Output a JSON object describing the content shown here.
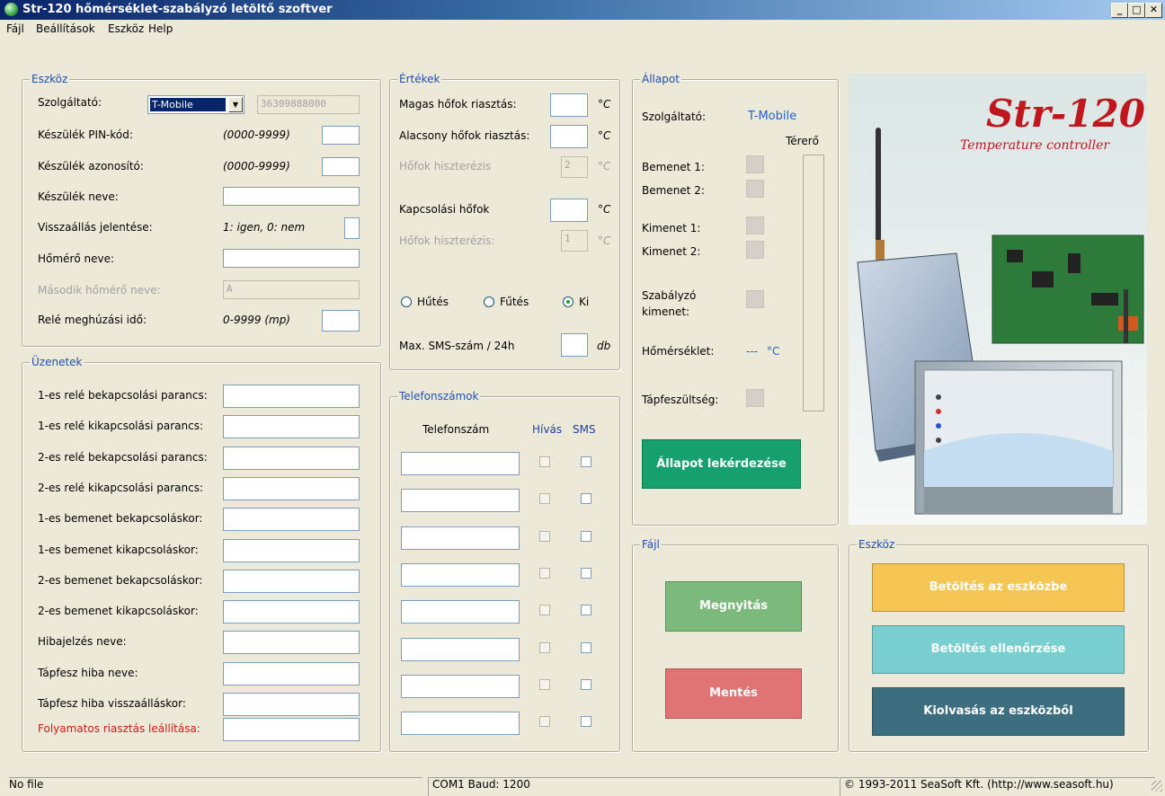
{
  "window": {
    "title": "Str-120 hőmérséklet-szabályzó letöltő szoftver",
    "minimize": "_",
    "maximize": "□",
    "close": "✕"
  },
  "menu": [
    "Fájl",
    "Beállítások",
    "Eszköz",
    "Help"
  ],
  "eszkoz": {
    "legend": "Eszköz",
    "szolgaltato_label": "Szolgáltató:",
    "szolgaltato_value": "T-Mobile",
    "phone_value": "36309888000",
    "pin_label": "Készülék PIN-kód:",
    "pin_hint": "(0000-9999)",
    "azonosito_label": "Készülék azonosító:",
    "azonosito_hint": "(0000-9999)",
    "nev_label": "Készülék neve:",
    "vissza_label": "Visszaállás jelentése:",
    "vissza_hint": "1: igen, 0: nem",
    "homero_label": "Hőmérő neve:",
    "masodik_label": "Második hőmérő neve:",
    "masodik_value": "A",
    "rele_label": "Relé meghúzási idő:",
    "rele_hint": "0-9999 (mp)"
  },
  "uzenetek": {
    "legend": "Üzenetek",
    "items": [
      "1-es relé bekapcsolási parancs:",
      "1-es relé kikapcsolási parancs:",
      "2-es relé bekapcsolási parancs:",
      "2-es relé kikapcsolási parancs:",
      "1-es bemenet bekapcsoláskor:",
      "1-es bemenet kikapcsoláskor:",
      "2-es bemenet bekapcsoláskor:",
      "2-es bemenet kikapcsoláskor:",
      "Hibajelzés neve:",
      "Tápfesz hiba neve:",
      "Tápfesz hiba visszaálláskor:"
    ],
    "stop_label": "Folyamatos riasztás leállítása:"
  },
  "ertekek": {
    "legend": "Értékek",
    "magas_label": "Magas hőfok riasztás:",
    "alacsony_label": "Alacsony hőfok riasztás:",
    "hiszt1_label": "Hőfok hiszterézis",
    "hiszt1_value": "2",
    "kapcs_label": "Kapcsolási hőfok",
    "hiszt2_label": "Hőfok hiszterézis:",
    "hiszt2_value": "1",
    "unit_c": "°C",
    "hutes": "Hűtés",
    "futes": "Fűtés",
    "ki": "Ki",
    "sms_label": "Max. SMS-szám / 24h",
    "sms_unit": "db"
  },
  "telefon": {
    "legend": "Telefonszámok",
    "col_szam": "Telefonszám",
    "col_hivas": "Hívás",
    "col_sms": "SMS"
  },
  "allapot": {
    "legend": "Állapot",
    "szolgaltato_label": "Szolgáltató:",
    "szolgaltato_value": "T-Mobile",
    "terero": "Térerő",
    "bemenet1": "Bemenet 1:",
    "bemenet2": "Bemenet 2:",
    "kimenet1": "Kimenet 1:",
    "kimenet2": "Kimenet 2:",
    "szab_line1": "Szabályzó",
    "szab_line2": "kimenet:",
    "homerseklet_label": "Hőmérséklet:",
    "homerseklet_value": "---",
    "homerseklet_unit": "°C",
    "tapfesz_label": "Tápfeszültség:",
    "button": "Állapot lekérdezése"
  },
  "banner": {
    "title": "Str-120",
    "subtitle": "Temperature controller"
  },
  "fajl": {
    "legend": "Fájl",
    "open": "Megnyitás",
    "save": "Mentés"
  },
  "eszkoz2": {
    "legend": "Eszköz",
    "upload": "Betöltés az eszközbe",
    "verify": "Betöltés ellenőrzése",
    "read": "Kiolvasás az eszközből"
  },
  "statusbar": {
    "file": "No file",
    "port": "COM1  Baud: 1200",
    "copyright": "© 1993-2011 SeaSoft Kft. (http://www.seasoft.hu)"
  },
  "colors": {
    "allapot_button": "#15a06e",
    "open_button": "#7cb97c",
    "save_button": "#e07474",
    "upload_button": "#f5c653",
    "verify_button": "#79cfcf",
    "read_button": "#3d6e80",
    "stop_label": "#d01818",
    "allapot_value": "#2060d0"
  }
}
